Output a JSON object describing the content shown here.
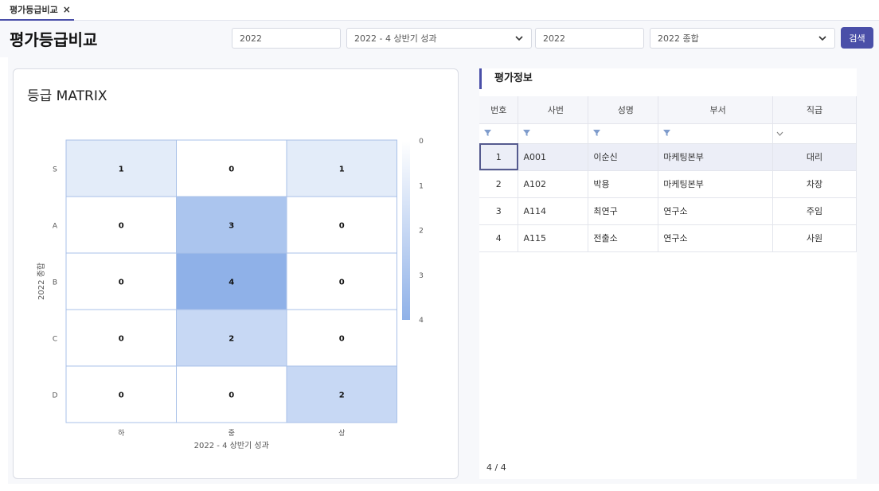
{
  "tab": {
    "label": "평가등급비교",
    "close": "×"
  },
  "page_title": "평가등급비교",
  "filters": {
    "year1": "2022",
    "term1": "2022 - 4 상반기 성과",
    "year2": "2022",
    "term2": "2022 종합",
    "search_label": "검색"
  },
  "matrix_card": {
    "title": "등급 MATRIX"
  },
  "chart_data": {
    "type": "heatmap",
    "title": "등급 MATRIX",
    "xlabel": "2022 - 4 상반기 성과",
    "ylabel": "2022 종합",
    "x_categories": [
      "하",
      "중",
      "상"
    ],
    "y_categories": [
      "S",
      "A",
      "B",
      "C",
      "D"
    ],
    "values": [
      [
        1,
        0,
        1
      ],
      [
        0,
        3,
        0
      ],
      [
        0,
        4,
        0
      ],
      [
        0,
        2,
        0
      ],
      [
        0,
        0,
        2
      ]
    ],
    "colorbar_ticks": [
      "0",
      "1",
      "2",
      "3",
      "4"
    ],
    "colorbar_range": [
      0,
      4
    ],
    "color_low": "#ffffff",
    "color_high": "#8fb1e8"
  },
  "info_panel": {
    "title": "평가정보",
    "columns": [
      "번호",
      "사번",
      "성명",
      "부서",
      "직급"
    ],
    "rows": [
      {
        "no": "1",
        "id": "A001",
        "name": "이순신",
        "dept": "마케팅본부",
        "position": "대리"
      },
      {
        "no": "2",
        "id": "A102",
        "name": "박용",
        "dept": "마케팅본부",
        "position": "차장"
      },
      {
        "no": "3",
        "id": "A114",
        "name": "최연구",
        "dept": "연구소",
        "position": "주임"
      },
      {
        "no": "4",
        "id": "A115",
        "name": "전출소",
        "dept": "연구소",
        "position": "사원"
      }
    ],
    "row_count": "4 / 4"
  },
  "colors": {
    "accent": "#4a4fa8",
    "border": "#d9dce4",
    "selected_row": "#eceef7"
  }
}
